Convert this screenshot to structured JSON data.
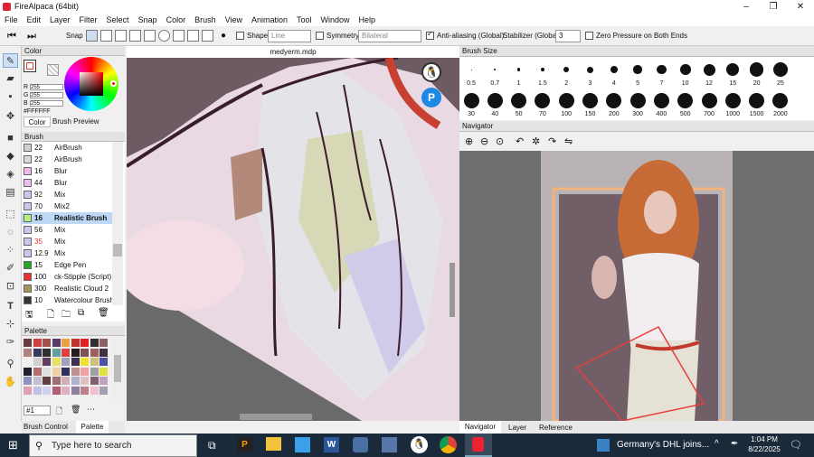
{
  "window": {
    "title": "FireAlpaca (64bit)",
    "min": "–",
    "max": "❐",
    "close": "✕"
  },
  "menu": [
    "File",
    "Edit",
    "Layer",
    "Filter",
    "Select",
    "Snap",
    "Color",
    "Brush",
    "View",
    "Animation",
    "Tool",
    "Window",
    "Help"
  ],
  "toolbar": {
    "snap": "Snap",
    "shape": "Shape",
    "shape_value": "Line",
    "symmetry": "Symmetry",
    "symmetry_value": "Bilateral",
    "antialias": "Anti-aliasing (Global)",
    "stabilizer": "Stabilizer (Global)",
    "stabilizer_value": "3",
    "zero_pressure": "Zero Pressure on Both Ends"
  },
  "color": {
    "title": "Color",
    "r_label": "R",
    "g_label": "G",
    "b_label": "B",
    "r": "255",
    "g": "255",
    "b": "255",
    "hex": "#FFFFFF",
    "tab_color": "Color",
    "tab_preview": "Brush Preview"
  },
  "brush": {
    "title": "Brush",
    "items": [
      {
        "size": "22",
        "name": "AirBrush",
        "color": "#cfcfcf"
      },
      {
        "size": "22",
        "name": "AirBrush",
        "color": "#d9d9d9"
      },
      {
        "size": "16",
        "name": "Blur",
        "color": "#f4b8e8"
      },
      {
        "size": "44",
        "name": "Blur",
        "color": "#f0bdf0"
      },
      {
        "size": "92",
        "name": "Mix",
        "color": "#c8c8f0"
      },
      {
        "size": "70",
        "name": "Mix2",
        "color": "#c8c8f0"
      },
      {
        "size": "16",
        "name": "Realistic Brush",
        "color": "#b7f07a"
      },
      {
        "size": "56",
        "name": "Mix",
        "color": "#c8c8f0"
      },
      {
        "size": "35",
        "name": "Mix",
        "color": "#c8c8f0"
      },
      {
        "size": "12.9",
        "name": "Mix",
        "color": "#c8c8f0"
      },
      {
        "size": "15",
        "name": "Edge Pen",
        "color": "#22aa22"
      },
      {
        "size": "100",
        "name": "ck-Stipple (Script)",
        "color": "#e83030"
      },
      {
        "size": "300",
        "name": "Realistic Cloud 2",
        "color": "#a89060"
      },
      {
        "size": "10",
        "name": "Watercolour Brush",
        "color": "#333"
      }
    ]
  },
  "palette": {
    "title": "Palette",
    "selector": "#1"
  },
  "left_tabs": {
    "brush_control": "Brush Control",
    "palette": "Palette"
  },
  "canvas": {
    "tab": "medyerm.mdp"
  },
  "brushsize": {
    "title": "Brush Size",
    "row1": [
      "0.5",
      "0.7",
      "1",
      "1.5",
      "2",
      "3",
      "4",
      "5",
      "7",
      "10",
      "12",
      "15",
      "20",
      "25"
    ],
    "row2": [
      "30",
      "40",
      "50",
      "70",
      "100",
      "150",
      "200",
      "300",
      "400",
      "500",
      "700",
      "1000",
      "1500",
      "2000"
    ]
  },
  "navigator": {
    "title": "Navigator"
  },
  "right_tabs": {
    "navigator": "Navigator",
    "layer": "Layer",
    "reference": "Reference"
  },
  "taskbar": {
    "search": "Type here to search",
    "news": "Germany's DHL joins...",
    "time": "1:04 PM",
    "date": "8/22/2025"
  }
}
